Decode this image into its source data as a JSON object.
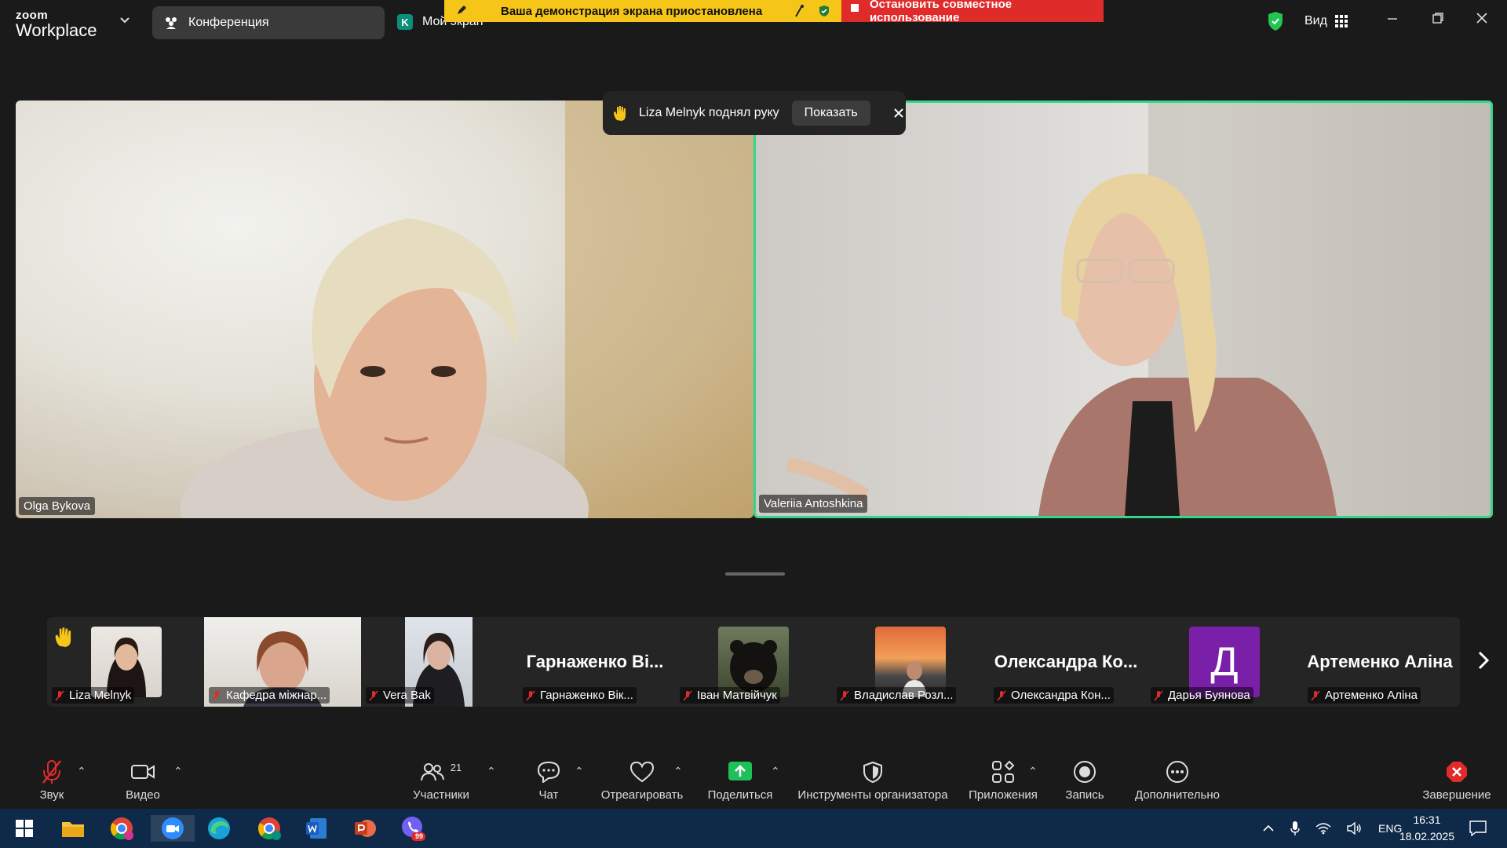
{
  "app": {
    "logo_line1": "zoom",
    "logo_line2": "Workplace"
  },
  "topbar": {
    "conference_tab": "Конференция",
    "my_screen_badge": "K",
    "my_screen": "Мой экран",
    "share_banner": "Ваша демонстрация экрана приостановлена",
    "stop_sharing": "Остановить совместное использование",
    "view_label": "Вид"
  },
  "notification": {
    "text": "Liza Melnyk поднял руку",
    "show_button": "Показать"
  },
  "videos": [
    {
      "name": "Olga Bykova"
    },
    {
      "name": "Valeriia Antoshkina"
    }
  ],
  "participants_strip": [
    {
      "name": "Liza Melnyk",
      "type": "photo",
      "hand_raised": true
    },
    {
      "name": "Кафедра міжнар...",
      "type": "video"
    },
    {
      "name": "Vera Bak",
      "type": "photo"
    },
    {
      "name": "Гарнаженко Вік...",
      "display": "Гарнаженко Ві...",
      "type": "text"
    },
    {
      "name": "Іван Матвійчук",
      "type": "photo"
    },
    {
      "name": "Владислав Розл...",
      "type": "photo"
    },
    {
      "name": "Олександра Кон...",
      "display": "Олександра Ко...",
      "type": "text"
    },
    {
      "name": "Дарья Буянова",
      "type": "avatar",
      "letter": "Д",
      "color": "#7a1fa8"
    },
    {
      "name": "Артеменко Аліна",
      "display": "Артеменко Аліна",
      "type": "text"
    }
  ],
  "toolbar": {
    "audio": "Звук",
    "video": "Видео",
    "participants": "Участники",
    "participants_count": "21",
    "chat": "Чат",
    "react": "Отреагировать",
    "share": "Поделиться",
    "host_tools": "Инструменты организатора",
    "apps": "Приложения",
    "record": "Запись",
    "more": "Дополнительно",
    "end": "Завершение"
  },
  "taskbar": {
    "lang": "ENG",
    "time": "16:31",
    "date": "18.02.2025",
    "viber_badge": "99"
  },
  "colors": {
    "accent_green": "#33d68a",
    "banner_yellow": "#f5c518",
    "stop_red": "#e02b2b",
    "end_red": "#e02b2b"
  }
}
